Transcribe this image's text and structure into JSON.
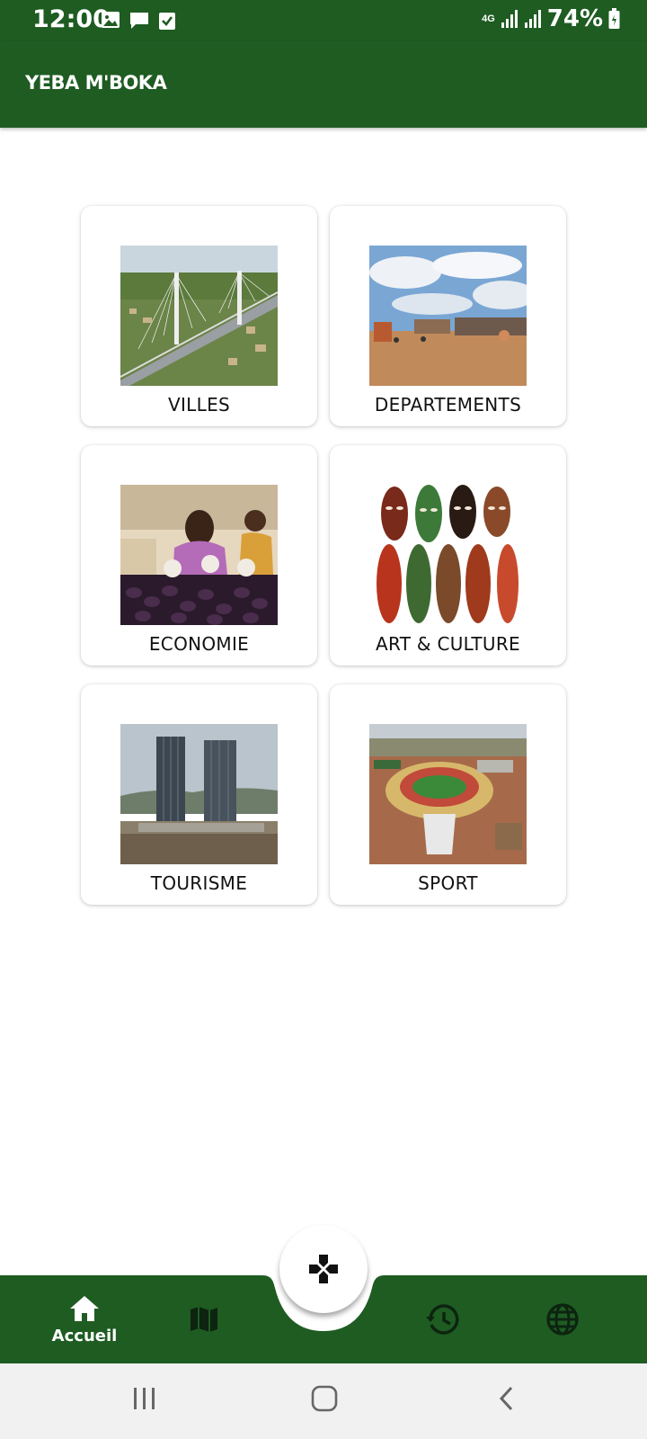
{
  "status_bar": {
    "time": "12:00",
    "network": "4G",
    "battery": "74%",
    "icons": [
      "image-icon",
      "message-icon",
      "check-icon",
      "signal-icon",
      "signal-icon",
      "battery-icon"
    ]
  },
  "app_bar": {
    "title": "YEBA M'BOKA"
  },
  "categories": [
    {
      "label": "VILLES",
      "image": "cable-bridge-city"
    },
    {
      "label": "DEPARTEMENTS",
      "image": "dirt-road-town"
    },
    {
      "label": "ECONOMIE",
      "image": "market-vendor"
    },
    {
      "label": "ART & CULTURE",
      "image": "african-masks"
    },
    {
      "label": "TOURISME",
      "image": "twin-towers"
    },
    {
      "label": "SPORT",
      "image": "stadium"
    }
  ],
  "bottom_nav": {
    "items": [
      {
        "label": "Accueil",
        "icon": "home-icon",
        "active": true
      },
      {
        "label": "",
        "icon": "map-icon"
      },
      {
        "label": "",
        "icon": "history-icon"
      },
      {
        "label": "",
        "icon": "globe-icon"
      }
    ],
    "fab_icon": "gamepad-icon"
  },
  "colors": {
    "primary": "#1e5c22",
    "active_text": "#ffffff",
    "inactive_icon": "#0d2410"
  }
}
